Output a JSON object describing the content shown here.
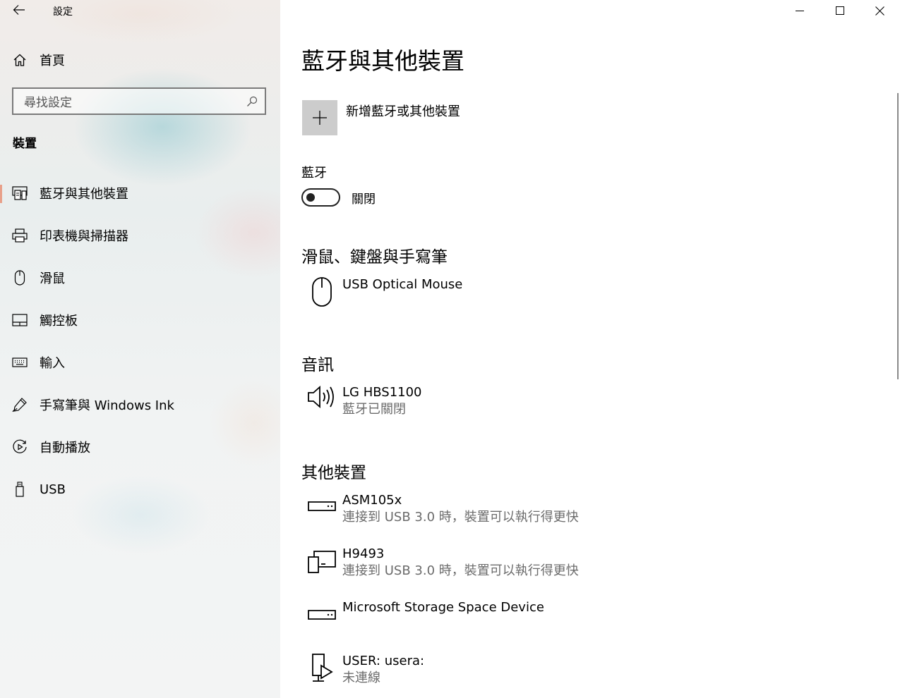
{
  "window": {
    "title": "設定"
  },
  "sidebar": {
    "home_label": "首頁",
    "search_placeholder": "尋找設定",
    "section_title": "裝置",
    "items": [
      {
        "label": "藍牙與其他裝置",
        "icon": "bluetooth-devices-icon",
        "active": true
      },
      {
        "label": "印表機與掃描器",
        "icon": "printer-icon"
      },
      {
        "label": "滑鼠",
        "icon": "mouse-icon"
      },
      {
        "label": "觸控板",
        "icon": "touchpad-icon"
      },
      {
        "label": "輸入",
        "icon": "keyboard-icon"
      },
      {
        "label": "手寫筆與 Windows Ink",
        "icon": "pen-icon"
      },
      {
        "label": "自動播放",
        "icon": "autoplay-icon"
      },
      {
        "label": "USB",
        "icon": "usb-icon"
      }
    ]
  },
  "main": {
    "page_title": "藍牙與其他裝置",
    "add_device_label": "新增藍牙或其他裝置",
    "bluetooth": {
      "label": "藍牙",
      "state_label": "關閉",
      "enabled": false
    },
    "groups": {
      "mouse": {
        "title": "滑鼠、鍵盤與手寫筆",
        "devices": [
          {
            "name": "USB Optical Mouse",
            "icon": "mouse-icon"
          }
        ]
      },
      "audio": {
        "title": "音訊",
        "devices": [
          {
            "name": "LG HBS1100",
            "status": "藍牙已關閉",
            "icon": "speaker-icon"
          }
        ]
      },
      "other": {
        "title": "其他裝置",
        "devices": [
          {
            "name": "ASM105x",
            "status": "連接到 USB 3.0 時，裝置可以執行得更快",
            "icon": "drive-icon"
          },
          {
            "name": "H9493",
            "status": "連接到 USB 3.0 時，裝置可以執行得更快",
            "icon": "multiple-devices-icon"
          },
          {
            "name": "Microsoft Storage Space Device",
            "icon": "drive-icon"
          },
          {
            "name": "USER: usera:",
            "status": "未連線",
            "icon": "media-device-icon"
          }
        ]
      }
    }
  }
}
